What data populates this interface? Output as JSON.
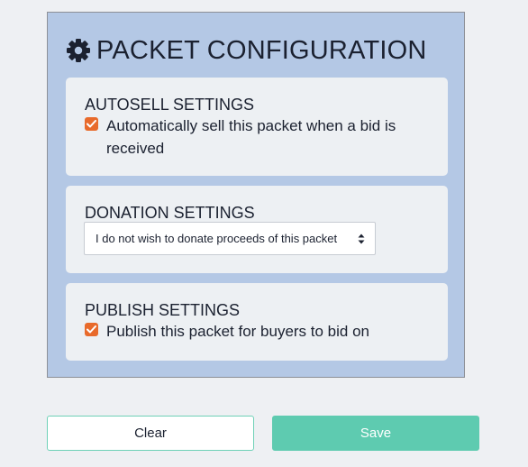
{
  "panel": {
    "title": "PACKET CONFIGURATION",
    "icon": "gear-icon"
  },
  "autosell": {
    "title": "AUTOSELL SETTINGS",
    "checkbox_checked": true,
    "checkbox_label_line1": "Automatically sell this packet when a bid is",
    "checkbox_label_line2": "received"
  },
  "donation": {
    "title": "DONATION SETTINGS",
    "selected_option": "I do not wish to donate proceeds of this packet"
  },
  "publish": {
    "title": "PUBLISH SETTINGS",
    "checkbox_checked": true,
    "checkbox_label": "Publish this packet for buyers to bid on"
  },
  "actions": {
    "clear_label": "Clear",
    "save_label": "Save"
  },
  "colors": {
    "panel_bg": "#b4c8e5",
    "checkbox_accent": "#e86a2b",
    "save_button": "#5ecbb0"
  }
}
